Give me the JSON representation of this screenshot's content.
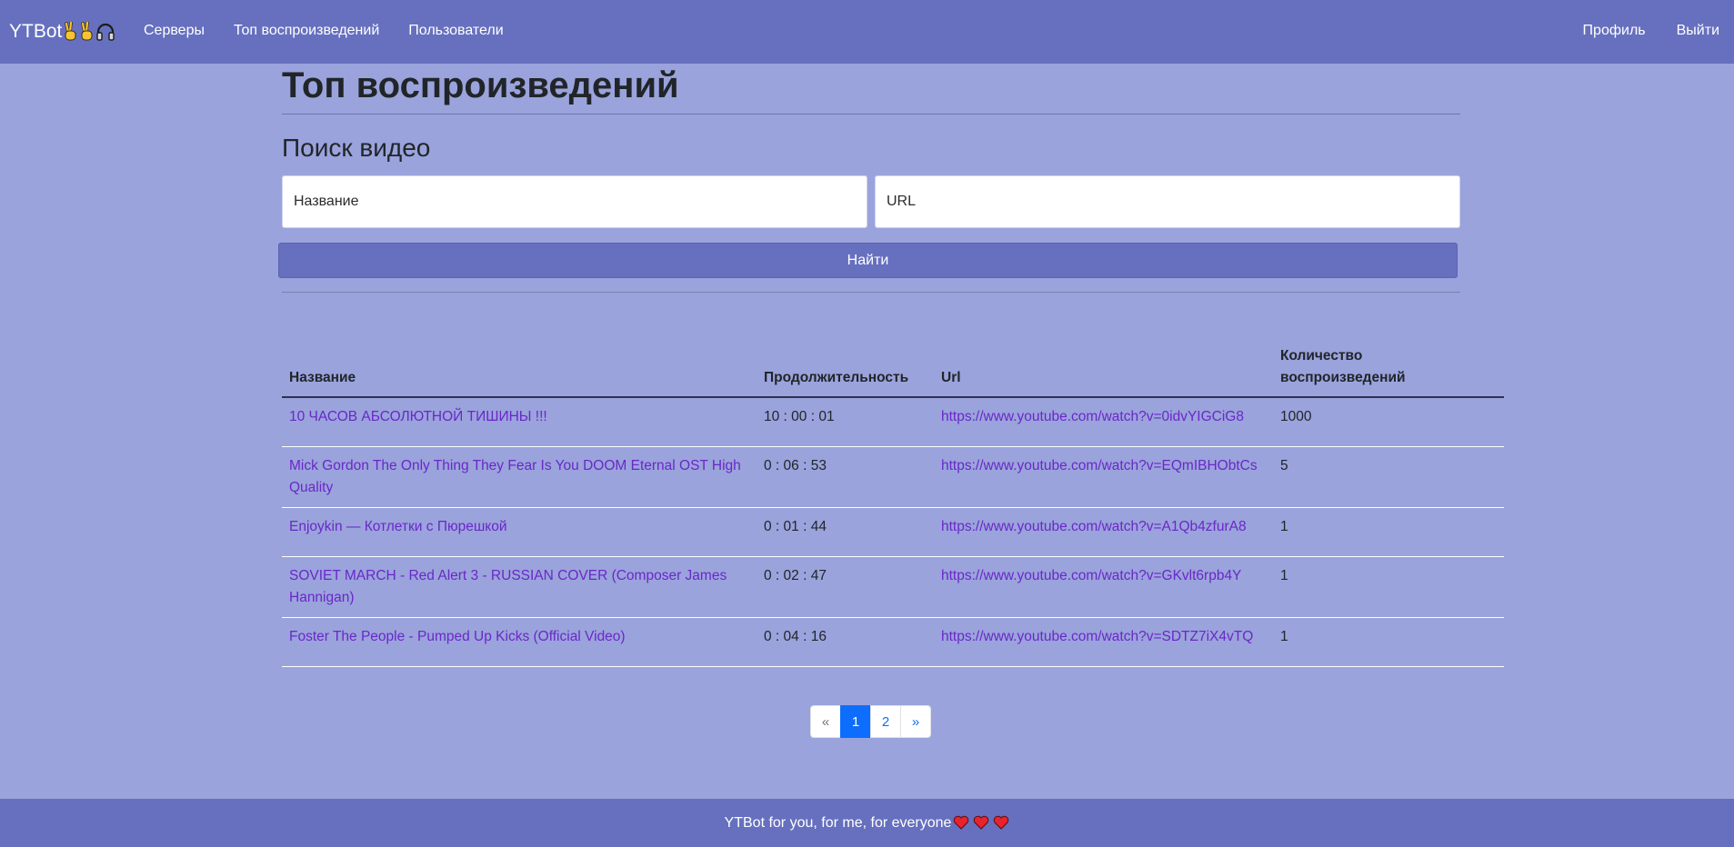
{
  "navbar": {
    "brand": "YTBot",
    "brand_icons": [
      "victory-hand-icon",
      "victory-hand-icon",
      "headphones-icon"
    ],
    "left_links": [
      "Серверы",
      "Топ воспроизведений",
      "Пользователи"
    ],
    "right_links": [
      "Профиль",
      "Выйти"
    ]
  },
  "page": {
    "title": "Топ воспроизведений",
    "search_title": "Поиск видео",
    "name_placeholder": "Название",
    "url_placeholder": "URL",
    "find_button": "Найти"
  },
  "table": {
    "headers": {
      "name": "Название",
      "duration": "Продолжительность",
      "url": "Url",
      "count": "Количество воспроизведений"
    },
    "rows": [
      {
        "name": "10 ЧАСОВ АБСОЛЮТНОЙ ТИШИНЫ !!!",
        "duration": "10 : 00 : 01",
        "url": "https://www.youtube.com/watch?v=0idvYIGCiG8",
        "count": "1000"
      },
      {
        "name": "Mick Gordon The Only Thing They Fear Is You DOOM Eternal OST High Quality",
        "duration": "0 : 06 : 53",
        "url": "https://www.youtube.com/watch?v=EQmIBHObtCs",
        "count": "5"
      },
      {
        "name": "Enjoykin — Котлетки с Пюрешкой",
        "duration": "0 : 01 : 44",
        "url": "https://www.youtube.com/watch?v=A1Qb4zfurA8",
        "count": "1"
      },
      {
        "name": "SOVIET MARCH - Red Alert 3 - RUSSIAN COVER (Composer James Hannigan)",
        "duration": "0 : 02 : 47",
        "url": "https://www.youtube.com/watch?v=GKvlt6rpb4Y",
        "count": "1"
      },
      {
        "name": "Foster The People - Pumped Up Kicks (Official Video)",
        "duration": "0 : 04 : 16",
        "url": "https://www.youtube.com/watch?v=SDTZ7iX4vTQ",
        "count": "1"
      }
    ]
  },
  "pagination": {
    "prev": "«",
    "pages": [
      "1",
      "2"
    ],
    "active": "1",
    "next": "»"
  },
  "footer": {
    "text": "YTBot for you, for me, for everyone",
    "heart_icons": [
      "heart-icon",
      "heart-icon",
      "heart-icon"
    ]
  },
  "colors": {
    "background": "#9aa3dc",
    "navbar": "#6670bf",
    "link": "#6a28c8",
    "page_active": "#0d6efd"
  }
}
